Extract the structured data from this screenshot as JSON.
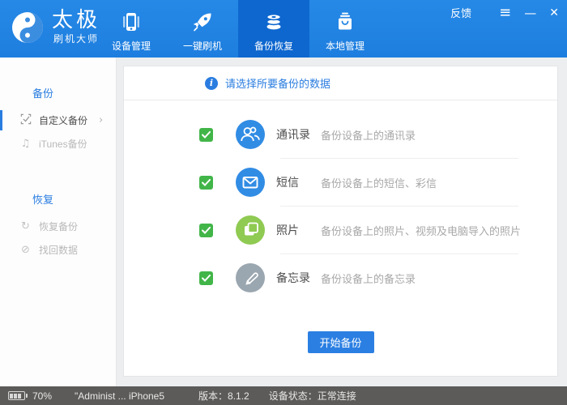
{
  "window": {
    "app_title": "太极",
    "app_subtitle": "刷机大师",
    "feedback_label": "反馈"
  },
  "icons_glyphs": {
    "menu": "≡",
    "minimize": "—",
    "close": "✕",
    "info": "i",
    "chevron_right": "›",
    "music_note": "♫",
    "restore": "↻",
    "recover": "⊘"
  },
  "nav": {
    "tabs": [
      {
        "label": "设备管理",
        "icon": "phone-icon",
        "active": false
      },
      {
        "label": "一键刷机",
        "icon": "rocket-icon",
        "active": false
      },
      {
        "label": "备份恢复",
        "icon": "database-icon",
        "active": true
      },
      {
        "label": "本地管理",
        "icon": "bag-icon",
        "active": false
      }
    ]
  },
  "sidebar": {
    "sections": [
      {
        "heading": "备份",
        "items": [
          {
            "label": "自定义备份",
            "icon": "custom-backup-icon",
            "selected": true
          },
          {
            "label": "iTunes备份",
            "icon": "music-note-icon",
            "selected": false
          }
        ]
      },
      {
        "heading": "恢复",
        "items": [
          {
            "label": "恢复备份",
            "icon": "restore-icon",
            "selected": false
          },
          {
            "label": "找回数据",
            "icon": "recover-data-icon",
            "selected": false
          }
        ]
      }
    ]
  },
  "main": {
    "banner": {
      "text": "请选择所要备份的数据"
    },
    "items": [
      {
        "label": "通讯录",
        "desc": "备份设备上的通讯录",
        "checked": true,
        "icon": "contacts-icon",
        "icon_color": "#318ce4"
      },
      {
        "label": "短信",
        "desc": "备份设备上的短信、彩信",
        "checked": true,
        "icon": "sms-icon",
        "icon_color": "#318ce4"
      },
      {
        "label": "照片",
        "desc": "备份设备上的照片、视频及电脑导入的照片",
        "checked": true,
        "icon": "photos-icon",
        "icon_color": "#8fca52"
      },
      {
        "label": "备忘录",
        "desc": "备份设备上的备忘录",
        "checked": true,
        "icon": "notes-icon",
        "icon_color": "#9aa6b0"
      }
    ],
    "start_button": "开始备份"
  },
  "statusbar": {
    "battery_percent": "70%",
    "device_name": "\"Administ ... iPhone5",
    "version_label": "版本：8.1.2",
    "status_label": "设备状态：正常连接"
  },
  "colors": {
    "header_blue": "#2285e2",
    "active_tab_blue": "#0e67cf",
    "accent_blue": "#2a7de0",
    "checkbox_green": "#42b549",
    "icon_green": "#8fca52",
    "icon_gray": "#9aa6b0",
    "statusbar_gray": "#5d5b59"
  }
}
